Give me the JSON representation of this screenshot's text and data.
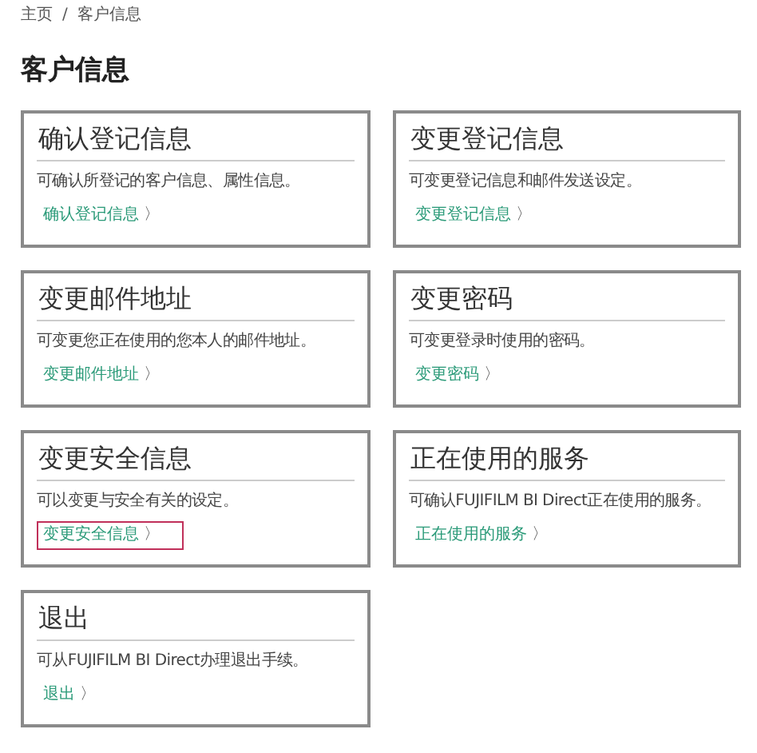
{
  "breadcrumb": [
    {
      "label": "主页"
    },
    {
      "label": "客户信息"
    }
  ],
  "breadcrumb_separator": "/",
  "title": "客户信息",
  "cards": [
    {
      "title": "确认登记信息",
      "description": "可确认所登记的客户信息、属性信息。",
      "link": "确认登记信息",
      "link_arrow": "〉",
      "highlighted": false
    },
    {
      "title": "变更登记信息",
      "description": "可变更登记信息和邮件发送设定。",
      "link": "变更登记信息",
      "link_arrow": "〉",
      "highlighted": false
    },
    {
      "title": "变更邮件地址",
      "description": "可变更您正在使用的您本人的邮件地址。",
      "link": "变更邮件地址",
      "link_arrow": "〉",
      "highlighted": false
    },
    {
      "title": "变更密码",
      "description": "可变更登录时使用的密码。",
      "link": "变更密码",
      "link_arrow": "〉",
      "highlighted": false
    },
    {
      "title": "变更安全信息",
      "description": "可以变更与安全有关的设定。",
      "link": "变更安全信息",
      "link_arrow": "〉",
      "highlighted": true
    },
    {
      "title": "正在使用的服务",
      "description": "可确认FUJIFILM BI Direct正在使用的服务。",
      "link": "正在使用的服务",
      "link_arrow": "〉",
      "highlighted": false
    },
    {
      "title": "退出",
      "description": "可从FUJIFILM BI Direct办理退出手续。",
      "link": "退出",
      "link_arrow": "〉",
      "highlighted": false
    }
  ]
}
